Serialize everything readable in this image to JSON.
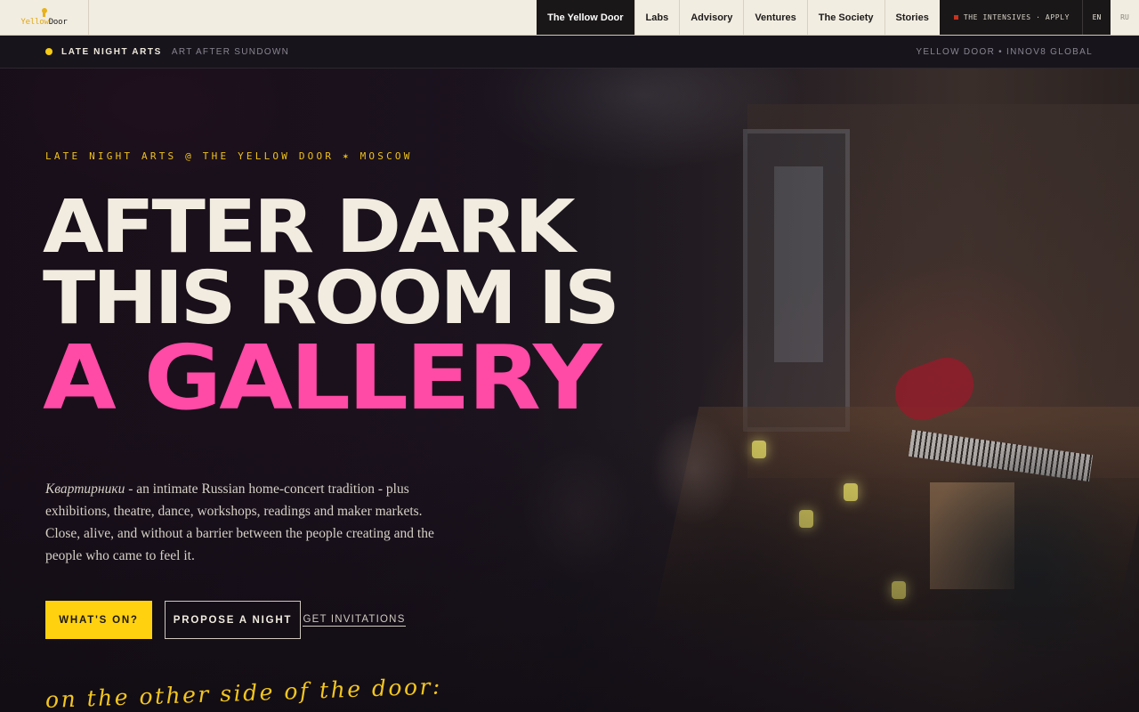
{
  "nav": {
    "logo_yellow": "Yellow",
    "logo_door": "Door",
    "items": [
      {
        "label": "The Yellow Door",
        "active": true
      },
      {
        "label": "Labs",
        "active": false
      },
      {
        "label": "Advisory",
        "active": false
      },
      {
        "label": "Ventures",
        "active": false
      },
      {
        "label": "The Society",
        "active": false
      },
      {
        "label": "Stories",
        "active": false
      }
    ],
    "intensives": "THE INTENSIVES · APPLY",
    "lang_en": "EN",
    "lang_ru": "RU"
  },
  "subbar": {
    "section": "LATE NIGHT ARTS",
    "tagline": "ART AFTER SUNDOWN",
    "right": "YELLOW DOOR • INNOV8 GLOBAL"
  },
  "hero": {
    "eyebrow": "LATE NIGHT ARTS @ THE YELLOW DOOR ✶ MOSCOW",
    "line1": "AFTER DARK",
    "line2": "THIS ROOM IS",
    "line3": "A GALLERY",
    "desc_em": "Квартирники",
    "desc_rest": " - an intimate Russian home-concert tradition - plus exhibitions, theatre, dance, workshops, readings and maker markets. Close, alive, and without a barrier between the people creating and the people who came to feel it.",
    "btn_primary": "WHAT'S ON?",
    "btn_secondary": "PROPOSE A NIGHT",
    "btn_link": "GET INVITATIONS",
    "script": "on the other side of the door:"
  },
  "colors": {
    "accent_yellow": "#ffd10f",
    "accent_pink": "#ff4aa6",
    "nav_bg": "#f2ede1",
    "dark": "#1a1718"
  }
}
